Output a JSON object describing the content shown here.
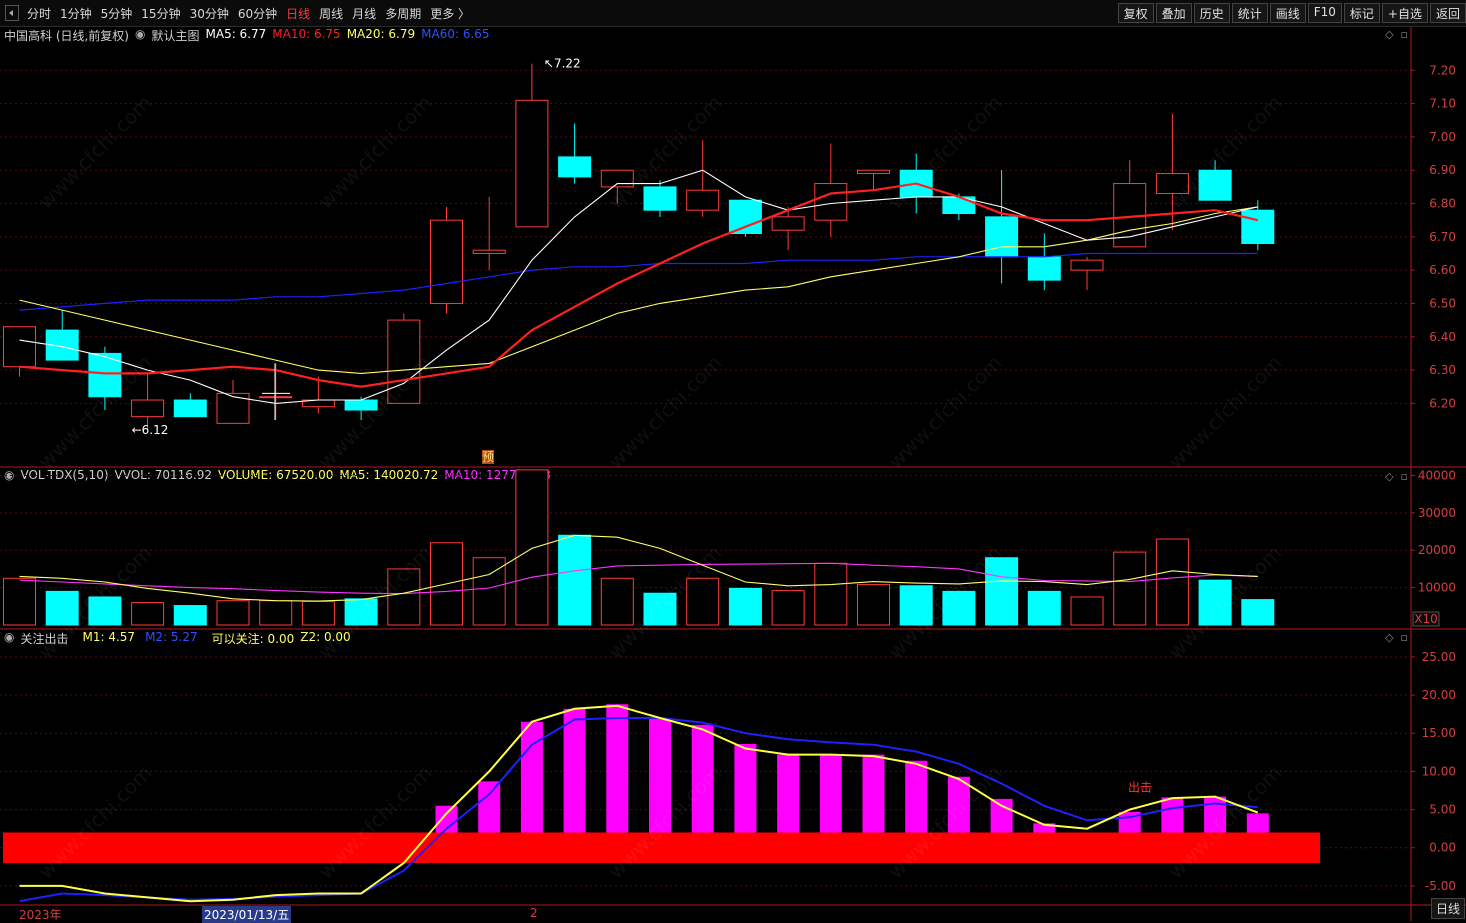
{
  "toolbar": {
    "periods": [
      "分时",
      "1分钟",
      "5分钟",
      "15分钟",
      "30分钟",
      "60分钟",
      "日线",
      "周线",
      "月线",
      "多周期",
      "更多 〉"
    ],
    "active_period": "日线",
    "actions": [
      "复权",
      "叠加",
      "历史",
      "统计",
      "画线",
      "F10",
      "标记",
      "+自选",
      "返回"
    ]
  },
  "main_legend": {
    "title": "中国高科 (日线,前复权)",
    "indicator_name": "默认主图",
    "ma5": "MA5: 6.77",
    "ma10": "MA10: 6.75",
    "ma20": "MA20: 6.79",
    "ma60": "MA60: 6.65"
  },
  "vol_legend": {
    "name": "VOL-TDX(5,10)",
    "vvol": "VVOL: 70116.92",
    "volume": "VOLUME: 67520.00",
    "ma5": "MA5: 140020.72",
    "ma10": "MA10: 127727.13"
  },
  "ind_legend": {
    "name": "关注出击",
    "m1": "M1: 4.57",
    "m2": "M2: 5.27",
    "focus": "可以关注: 0.00",
    "z2": "Z2: 0.00"
  },
  "annotations": {
    "high": "7.22",
    "low": "6.12",
    "forecast_mark": "预",
    "exit_signal": "出击",
    "x10": "X10"
  },
  "bottom_axis": {
    "year": "2023年",
    "cursor_date": "2023/01/13/五",
    "month_mark": "2",
    "period_btn": "日线"
  },
  "watermark": "www.cfchi.com",
  "colors": {
    "up": "#ff3b3b",
    "down": "#00ffff",
    "ma5": "#ffffff",
    "ma10": "#ff2020",
    "ma20": "#ffff66",
    "ma60": "#2020ff",
    "vol_ma5": "#ffff66",
    "vol_ma10": "#ff33ff",
    "bar_pink": "#ff00ff",
    "band": "#ff0000"
  },
  "chart_data": [
    {
      "type": "candlestick",
      "title": "中国高科 (日线,前复权)",
      "y_ticks": [
        6.2,
        6.3,
        6.4,
        6.5,
        6.6,
        6.7,
        6.8,
        6.9,
        7.0,
        7.1,
        7.2
      ],
      "ylim": [
        6.09,
        7.27
      ],
      "candles": [
        {
          "o": 6.31,
          "c": 6.43,
          "h": 6.43,
          "l": 6.28
        },
        {
          "o": 6.42,
          "c": 6.33,
          "h": 6.48,
          "l": 6.33
        },
        {
          "o": 6.35,
          "c": 6.22,
          "h": 6.37,
          "l": 6.18
        },
        {
          "o": 6.16,
          "c": 6.21,
          "h": 6.29,
          "l": 6.12
        },
        {
          "o": 6.21,
          "c": 6.16,
          "h": 6.23,
          "l": 6.16
        },
        {
          "o": 6.14,
          "c": 6.23,
          "h": 6.27,
          "l": 6.14
        },
        {
          "o": 6.22,
          "c": 6.22,
          "h": 6.32,
          "l": 6.15
        },
        {
          "o": 6.19,
          "c": 6.21,
          "h": 6.28,
          "l": 6.17
        },
        {
          "o": 6.21,
          "c": 6.18,
          "h": 6.22,
          "l": 6.15
        },
        {
          "o": 6.2,
          "c": 6.45,
          "h": 6.47,
          "l": 6.2
        },
        {
          "o": 6.5,
          "c": 6.75,
          "h": 6.79,
          "l": 6.47
        },
        {
          "o": 6.65,
          "c": 6.66,
          "h": 6.82,
          "l": 6.6
        },
        {
          "o": 6.73,
          "c": 7.11,
          "h": 7.22,
          "l": 6.73
        },
        {
          "o": 6.94,
          "c": 6.88,
          "h": 7.04,
          "l": 6.86
        },
        {
          "o": 6.85,
          "c": 6.9,
          "h": 6.9,
          "l": 6.8
        },
        {
          "o": 6.85,
          "c": 6.78,
          "h": 6.87,
          "l": 6.76
        },
        {
          "o": 6.78,
          "c": 6.84,
          "h": 6.99,
          "l": 6.76
        },
        {
          "o": 6.81,
          "c": 6.71,
          "h": 6.81,
          "l": 6.7
        },
        {
          "o": 6.72,
          "c": 6.76,
          "h": 6.79,
          "l": 6.66
        },
        {
          "o": 6.75,
          "c": 6.86,
          "h": 6.98,
          "l": 6.7
        },
        {
          "o": 6.89,
          "c": 6.9,
          "h": 6.9,
          "l": 6.84
        },
        {
          "o": 6.9,
          "c": 6.82,
          "h": 6.95,
          "l": 6.77
        },
        {
          "o": 6.82,
          "c": 6.77,
          "h": 6.83,
          "l": 6.75
        },
        {
          "o": 6.76,
          "c": 6.64,
          "h": 6.9,
          "l": 6.56
        },
        {
          "o": 6.64,
          "c": 6.57,
          "h": 6.71,
          "l": 6.54
        },
        {
          "o": 6.6,
          "c": 6.63,
          "h": 6.64,
          "l": 6.54
        },
        {
          "o": 6.67,
          "c": 6.86,
          "h": 6.93,
          "l": 6.67
        },
        {
          "o": 6.83,
          "c": 6.89,
          "h": 7.07,
          "l": 6.72
        },
        {
          "o": 6.9,
          "c": 6.81,
          "h": 6.93,
          "l": 6.81
        },
        {
          "o": 6.78,
          "c": 6.68,
          "h": 6.81,
          "l": 6.66
        }
      ],
      "ma5": [
        6.39,
        6.37,
        6.34,
        6.3,
        6.27,
        6.22,
        6.2,
        6.21,
        6.21,
        6.26,
        6.36,
        6.45,
        6.63,
        6.76,
        6.86,
        6.86,
        6.9,
        6.82,
        6.78,
        6.8,
        6.81,
        6.82,
        6.82,
        6.79,
        6.74,
        6.69,
        6.7,
        6.73,
        6.76,
        6.79
      ],
      "ma10": [
        6.31,
        6.3,
        6.29,
        6.29,
        6.3,
        6.31,
        6.3,
        6.27,
        6.25,
        6.27,
        6.29,
        6.31,
        6.42,
        6.49,
        6.56,
        6.62,
        6.68,
        6.73,
        6.78,
        6.83,
        6.84,
        6.86,
        6.82,
        6.77,
        6.75,
        6.75,
        6.76,
        6.77,
        6.78,
        6.75
      ],
      "ma20": [
        6.51,
        6.48,
        6.45,
        6.42,
        6.39,
        6.36,
        6.33,
        6.3,
        6.29,
        6.3,
        6.31,
        6.32,
        6.37,
        6.42,
        6.47,
        6.5,
        6.52,
        6.54,
        6.55,
        6.58,
        6.6,
        6.62,
        6.64,
        6.67,
        6.67,
        6.69,
        6.72,
        6.74,
        6.77,
        6.79
      ],
      "ma60": [
        6.48,
        6.49,
        6.5,
        6.51,
        6.51,
        6.51,
        6.52,
        6.52,
        6.53,
        6.54,
        6.56,
        6.58,
        6.6,
        6.61,
        6.61,
        6.62,
        6.62,
        6.62,
        6.63,
        6.63,
        6.63,
        6.64,
        6.64,
        6.64,
        6.64,
        6.65,
        6.65,
        6.65,
        6.65,
        6.65
      ]
    },
    {
      "type": "bar",
      "title": "VOL-TDX(5,10)",
      "unit": "X10",
      "y_ticks": [
        10000,
        20000,
        30000,
        40000
      ],
      "ylim": [
        0,
        42000
      ],
      "volumes": [
        12500,
        9000,
        7500,
        6000,
        5200,
        6500,
        6500,
        6300,
        7000,
        15000,
        22000,
        18000,
        41500,
        24000,
        12500,
        8500,
        12500,
        9800,
        9200,
        16500,
        10800,
        10500,
        9000,
        18000,
        9000,
        7500,
        19500,
        23000,
        12000,
        6800
      ],
      "ma5": [
        13000,
        12500,
        11500,
        9800,
        8500,
        7000,
        6500,
        6400,
        6800,
        8500,
        11000,
        13500,
        20500,
        24000,
        23500,
        20500,
        16000,
        11500,
        10500,
        10800,
        11600,
        11200,
        11000,
        11800,
        11600,
        10800,
        12200,
        14500,
        13500,
        13000
      ],
      "ma10": [
        12000,
        11500,
        11000,
        10500,
        10000,
        9700,
        9200,
        8800,
        8500,
        8400,
        9000,
        9900,
        12800,
        14500,
        15800,
        16000,
        16200,
        16300,
        16400,
        16500,
        16000,
        15600,
        15000,
        12900,
        11900,
        11800,
        11600,
        12600,
        13400,
        13000
      ]
    },
    {
      "type": "bar",
      "title": "关注出击",
      "y_ticks": [
        -5,
        0,
        5,
        10,
        15,
        20,
        25
      ],
      "ylim": [
        -7.5,
        28
      ],
      "bars": [
        null,
        null,
        null,
        null,
        null,
        null,
        null,
        null,
        null,
        null,
        5.5,
        8.7,
        16.5,
        18.2,
        18.8,
        17.0,
        16.1,
        13.6,
        12.2,
        12.2,
        12.2,
        11.4,
        9.3,
        6.4,
        3.2,
        1.8,
        4.7,
        6.6,
        6.7,
        4.5
      ],
      "m1": [
        -5.0,
        -5.0,
        -6.0,
        -6.5,
        -7.0,
        -6.8,
        -6.2,
        -6.0,
        -6.0,
        -2.0,
        4.5,
        10.0,
        16.5,
        18.2,
        18.6,
        17.0,
        15.5,
        13.0,
        12.2,
        12.2,
        12.0,
        11.0,
        9.0,
        5.5,
        3.0,
        2.5,
        5.0,
        6.5,
        6.7,
        4.6
      ],
      "m2": [
        -7.0,
        -6.0,
        -6.2,
        -6.5,
        -6.8,
        -6.7,
        -6.4,
        -6.2,
        -6.0,
        -3.0,
        2.5,
        7.0,
        13.5,
        16.8,
        17.0,
        17.0,
        16.4,
        15.0,
        14.2,
        13.8,
        13.5,
        12.6,
        11.0,
        8.4,
        5.5,
        3.6,
        4.0,
        5.2,
        5.8,
        5.3
      ],
      "band": [
        -2,
        2
      ]
    }
  ]
}
